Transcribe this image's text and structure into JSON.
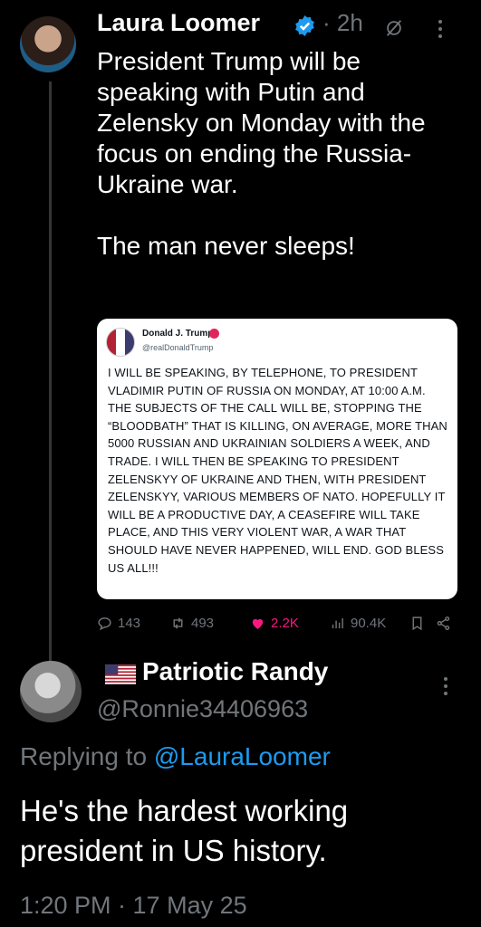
{
  "tweet": {
    "author_name": "Laura Loomer",
    "time": "· 2h",
    "text": "President Trump will be speaking with Putin and Zelensky on Monday with the focus on ending the Russia-Ukraine war.\n\nThe man never sleeps!",
    "embedded": {
      "name": "Donald J. Trump",
      "handle": "@realDonaldTrump",
      "text": "I WILL BE SPEAKING, BY TELEPHONE, TO PRESIDENT VLADIMIR PUTIN OF RUSSIA ON MONDAY, AT 10:00 A.M. THE SUBJECTS OF THE CALL WILL BE, STOPPING THE “BLOODBATH” THAT IS KILLING, ON AVERAGE, MORE THAN 5000 RUSSIAN AND UKRAINIAN SOLDIERS A WEEK, AND TRADE. I WILL THEN BE SPEAKING TO PRESIDENT ZELENSKYY OF UKRAINE AND THEN, WITH PRESIDENT ZELENSKYY, VARIOUS MEMBERS OF NATO. HOPEFULLY IT WILL BE A PRODUCTIVE DAY, A CEASEFIRE WILL TAKE PLACE, AND THIS VERY VIOLENT WAR, A WAR THAT SHOULD HAVE NEVER HAPPENED, WILL END. GOD BLESS US ALL!!!"
    },
    "actions": {
      "replies": "143",
      "reposts": "493",
      "likes": "2.2K",
      "views": "90.4K"
    }
  },
  "reply": {
    "name": "Patriotic Randy",
    "handle": "@Ronnie34406963",
    "replying_prefix": "Replying to ",
    "replying_to": "@LauraLoomer",
    "text": "He's the hardest working president in US history.",
    "meta": "1:20 PM · 17 May 25"
  },
  "icons": {
    "verified": "verified-badge-icon",
    "grok": "grok-icon",
    "more": "more-options-icon",
    "reply": "reply-icon",
    "repost": "repost-icon",
    "like": "heart-icon",
    "views": "views-icon",
    "bookmark": "bookmark-icon",
    "share": "share-icon",
    "flag": "us-flag-icon"
  },
  "colors": {
    "background": "#000000",
    "accent": "#1d9bf0",
    "like": "#f91880",
    "muted": "#71767b"
  }
}
